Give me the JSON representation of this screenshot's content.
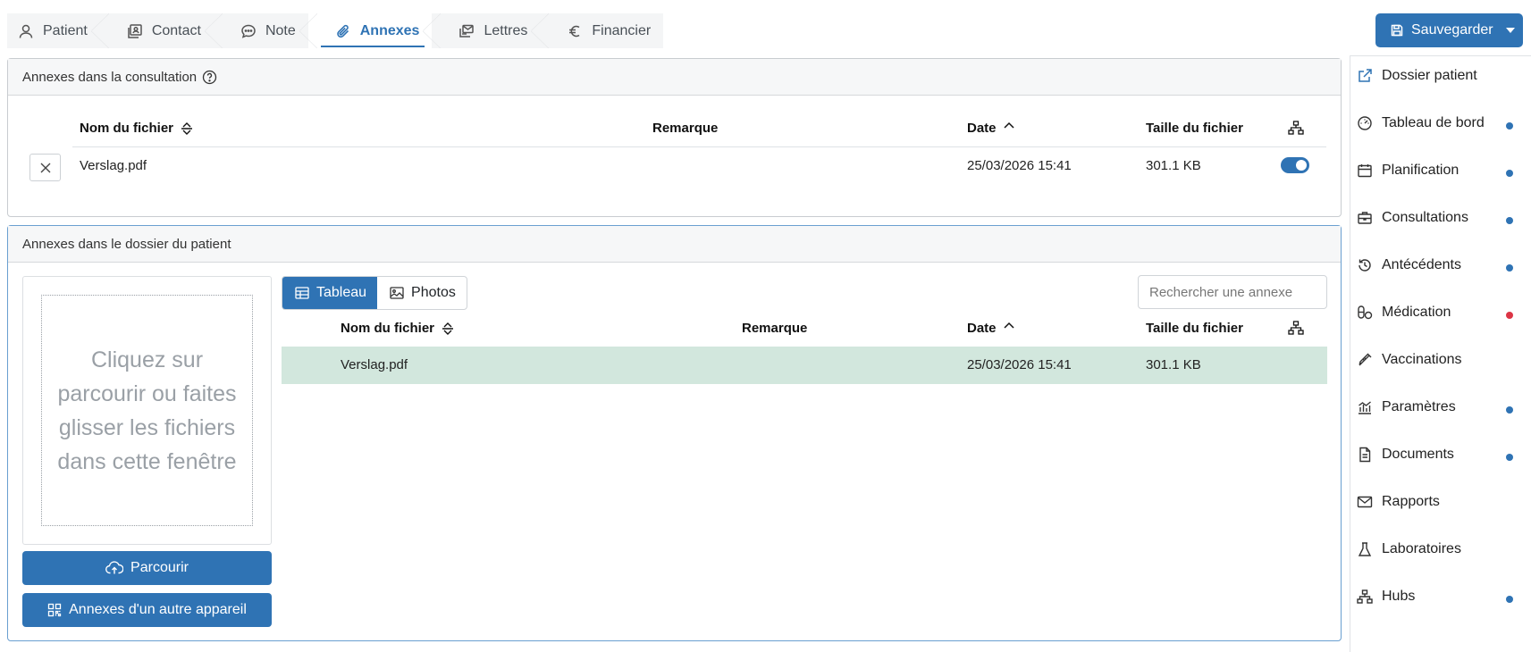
{
  "tabs": [
    {
      "label": "Patient",
      "icon": "person-icon"
    },
    {
      "label": "Contact",
      "icon": "contact-card-icon"
    },
    {
      "label": "Note",
      "icon": "chat-icon"
    },
    {
      "label": "Annexes",
      "icon": "paperclip-icon",
      "active": true
    },
    {
      "label": "Lettres",
      "icon": "letters-icon"
    },
    {
      "label": "Financier",
      "icon": "euro-icon"
    }
  ],
  "save_button": {
    "label": "Sauvegarder"
  },
  "consultation_panel": {
    "title": "Annexes dans la consultation",
    "columns": {
      "filename": "Nom du fichier",
      "remark": "Remarque",
      "date": "Date",
      "size": "Taille du fichier"
    },
    "rows": [
      {
        "filename": "Verslag.pdf",
        "remark": "",
        "date": "25/03/2026 15:41",
        "size": "301.1 KB",
        "shared": true
      }
    ]
  },
  "patient_panel": {
    "title": "Annexes dans le dossier du patient",
    "dropzone_text": "Cliquez sur parcourir ou faites glisser les fichiers dans cette fenêtre",
    "browse_label": "Parcourir",
    "other_device_label": "Annexes d'un autre appareil",
    "view_tabs": {
      "table": "Tableau",
      "photos": "Photos"
    },
    "search_placeholder": "Rechercher une annexe",
    "columns": {
      "filename": "Nom du fichier",
      "remark": "Remarque",
      "date": "Date",
      "size": "Taille du fichier"
    },
    "rows": [
      {
        "filename": "Verslag.pdf",
        "remark": "",
        "date": "25/03/2026 15:41",
        "size": "301.1 KB"
      }
    ]
  },
  "sidebar": [
    {
      "label": "Dossier patient",
      "icon": "external-link-icon",
      "dot": null
    },
    {
      "label": "Tableau de bord",
      "icon": "dashboard-icon",
      "dot": "#2f73b4"
    },
    {
      "label": "Planification",
      "icon": "calendar-icon",
      "dot": "#2f73b4"
    },
    {
      "label": "Consultations",
      "icon": "briefcase-icon",
      "dot": "#2f73b4"
    },
    {
      "label": "Antécédents",
      "icon": "history-icon",
      "dot": "#2f73b4"
    },
    {
      "label": "Médication",
      "icon": "pills-icon",
      "dot": "#dc3545"
    },
    {
      "label": "Vaccinations",
      "icon": "syringe-icon",
      "dot": null
    },
    {
      "label": "Paramètres",
      "icon": "bar-chart-icon",
      "dot": "#2f73b4"
    },
    {
      "label": "Documents",
      "icon": "document-icon",
      "dot": "#2f73b4"
    },
    {
      "label": "Rapports",
      "icon": "envelope-icon",
      "dot": null
    },
    {
      "label": "Laboratoires",
      "icon": "flask-icon",
      "dot": null
    },
    {
      "label": "Hubs",
      "icon": "network-icon",
      "dot": "#2f73b4"
    }
  ],
  "colors": {
    "primary": "#2f73b4",
    "highlight_row": "#d2e7dd",
    "alert": "#dc3545"
  }
}
